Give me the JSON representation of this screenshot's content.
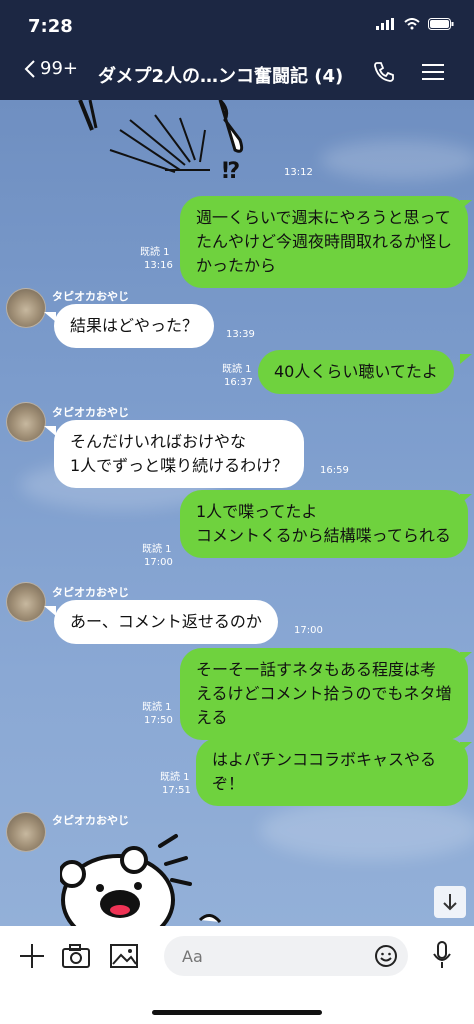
{
  "status": {
    "time": "7:28"
  },
  "header": {
    "back_count": "99+",
    "title": "ダメプ2人の…ンコ奮闘記 (4)"
  },
  "messages": [
    {
      "id": "m0",
      "time": "13:12"
    },
    {
      "id": "m1",
      "text": "週一くらいで週末にやろうと思ってたんやけど今週夜時間取れるか怪しかったから",
      "read": "既読 1",
      "time": "13:16"
    },
    {
      "id": "m2",
      "sender": "タピオカおやじ",
      "text": "結果はどやった？",
      "time": "13:39"
    },
    {
      "id": "m3",
      "text": "40人くらい聴いてたよ",
      "read": "既読 1",
      "time": "16:37"
    },
    {
      "id": "m4",
      "sender": "タピオカおやじ",
      "text": "そんだけいればおけやな\n1人でずっと喋り続けるわけ？",
      "time": "16:59"
    },
    {
      "id": "m5",
      "text": "1人で喋ってたよ\nコメントくるから結構喋ってられる",
      "read": "既読 1",
      "time": "17:00"
    },
    {
      "id": "m6",
      "sender": "タピオカおやじ",
      "text": "あー、コメント返せるのか",
      "time": "17:00"
    },
    {
      "id": "m7",
      "text": "そーそー話すネタもある程度は考えるけどコメント拾うのでもネタ増える",
      "read": "既読 1",
      "time": "17:50"
    },
    {
      "id": "m8",
      "text": "はよパチンココラボキャスやるぞ！",
      "read": "既読 1",
      "time": "17:51"
    },
    {
      "id": "m9",
      "sender": "タピオカおやじ"
    }
  ],
  "input": {
    "placeholder": "Aa"
  },
  "colors": {
    "header_bg": "#1c2743",
    "outgoing_bubble": "#6fd23e",
    "incoming_bubble": "#ffffff"
  }
}
